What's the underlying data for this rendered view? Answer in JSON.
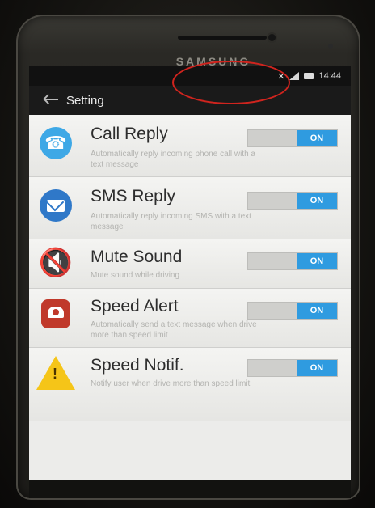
{
  "device": {
    "brand": "SAMSUNG"
  },
  "status_bar": {
    "time": "14:44"
  },
  "action_bar": {
    "title": "Setting"
  },
  "settings": [
    {
      "title": "Call Reply",
      "description": "Automatically reply incoming phone call with a text message",
      "toggle": "ON",
      "icon": "phone-icon"
    },
    {
      "title": "SMS Reply",
      "description": "Automatically reply incoming SMS with a text message",
      "toggle": "ON",
      "icon": "envelope-icon"
    },
    {
      "title": "Mute Sound",
      "description": "Mute sound while driving",
      "toggle": "ON",
      "icon": "mute-icon"
    },
    {
      "title": "Speed Alert",
      "description": "Automatically send a text message when drive more than speed limit",
      "toggle": "ON",
      "icon": "alarm-icon"
    },
    {
      "title": "Speed Notif.",
      "description": "Notify user when drive more than speed limit",
      "toggle": "ON",
      "icon": "warning-icon"
    }
  ],
  "colors": {
    "toggle_on": "#2f9be0",
    "annotation": "#d0241e"
  }
}
